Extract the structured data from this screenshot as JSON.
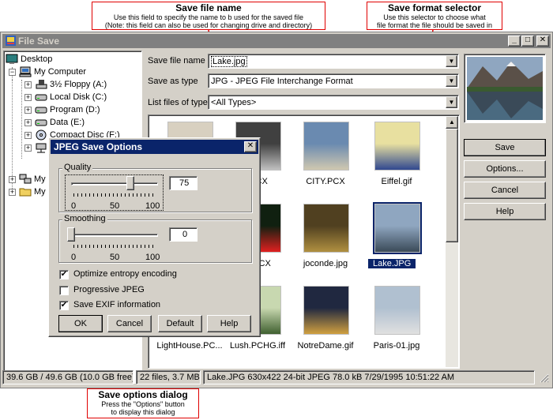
{
  "window": {
    "title": "File Save"
  },
  "callouts": {
    "save_file_name": {
      "title": "Save file name",
      "line1": "Use this field to specify the name to b used for the saved file",
      "line2": "(Note: this field can also be used for changing drive and directory)"
    },
    "save_format_selector": {
      "title": "Save format selector",
      "line1": "Use this selector to choose what",
      "line2": "file format the file should be saved in"
    },
    "save_options_dialog": {
      "title": "Save options dialog",
      "line1": "Press the \"Options\" button",
      "line2": "to display this dialog"
    }
  },
  "tree": {
    "items": [
      {
        "label": "Desktop",
        "icon": "desktop-icon"
      },
      {
        "label": "My Computer",
        "icon": "computer-icon"
      },
      {
        "label": "3½ Floppy (A:)",
        "icon": "floppy-icon"
      },
      {
        "label": "Local Disk (C:)",
        "icon": "disk-icon"
      },
      {
        "label": "Program (D:)",
        "icon": "disk-icon"
      },
      {
        "label": "Data (E:)",
        "icon": "disk-icon"
      },
      {
        "label": "Compact Disc (F:)",
        "icon": "cd-icon"
      },
      {
        "label": "",
        "icon": "network-drive-icon"
      },
      {
        "label": "My",
        "icon": "network-icon"
      },
      {
        "label": "My",
        "icon": "folder-icon"
      }
    ]
  },
  "fields": {
    "file_name_label": "Save file name",
    "file_name_value": "Lake.jpg",
    "save_as_type_label": "Save as type",
    "save_as_type_value": "JPG - JPEG File Interchange Format",
    "list_type_label": "List files of type",
    "list_type_value": "<All Types>"
  },
  "files": [
    {
      "name": "",
      "row": 0,
      "col": 0
    },
    {
      "name": ".PCX",
      "row": 0,
      "col": 1
    },
    {
      "name": "CITY.PCX",
      "row": 0,
      "col": 2
    },
    {
      "name": "Eiffel.gif",
      "row": 0,
      "col": 3
    },
    {
      "name": "",
      "row": 1,
      "col": 0
    },
    {
      "name": "R.PCX",
      "row": 1,
      "col": 1
    },
    {
      "name": "joconde.jpg",
      "row": 1,
      "col": 2
    },
    {
      "name": "Lake.JPG",
      "row": 1,
      "col": 3,
      "selected": true
    },
    {
      "name": "LightHouse.PC...",
      "row": 2,
      "col": 0
    },
    {
      "name": "Lush.PCHG.iff",
      "row": 2,
      "col": 1
    },
    {
      "name": "NotreDame.gif",
      "row": 2,
      "col": 2
    },
    {
      "name": "Paris-01.jpg",
      "row": 2,
      "col": 3
    }
  ],
  "buttons": {
    "save": "Save",
    "options": "Options...",
    "cancel": "Cancel",
    "help": "Help"
  },
  "status": {
    "disk": "39.6 GB / 49.6 GB (10.0 GB free)",
    "count": "22 files, 3.7 MB",
    "file_info": "Lake.JPG   630x422 24-bit JPEG   78.0 kB   7/29/1995 10:51:22 AM"
  },
  "dialog": {
    "title": "JPEG Save Options",
    "quality_label": "Quality",
    "quality_value": "75",
    "quality_level": 75,
    "smoothing_label": "Smoothing",
    "smoothing_value": "0",
    "smoothing_level": 0,
    "ticks": [
      "0",
      "50",
      "100"
    ],
    "opt_entropy": "Optimize entropy encoding",
    "opt_entropy_checked": true,
    "opt_progressive": "Progressive JPEG",
    "opt_progressive_checked": false,
    "opt_exif": "Save EXIF information",
    "opt_exif_checked": true,
    "ok": "OK",
    "cancel": "Cancel",
    "default": "Default",
    "help": "Help"
  },
  "colors": {
    "selection": "#0a246a",
    "callout_border": "#e00000",
    "face": "#d4d0c8"
  }
}
